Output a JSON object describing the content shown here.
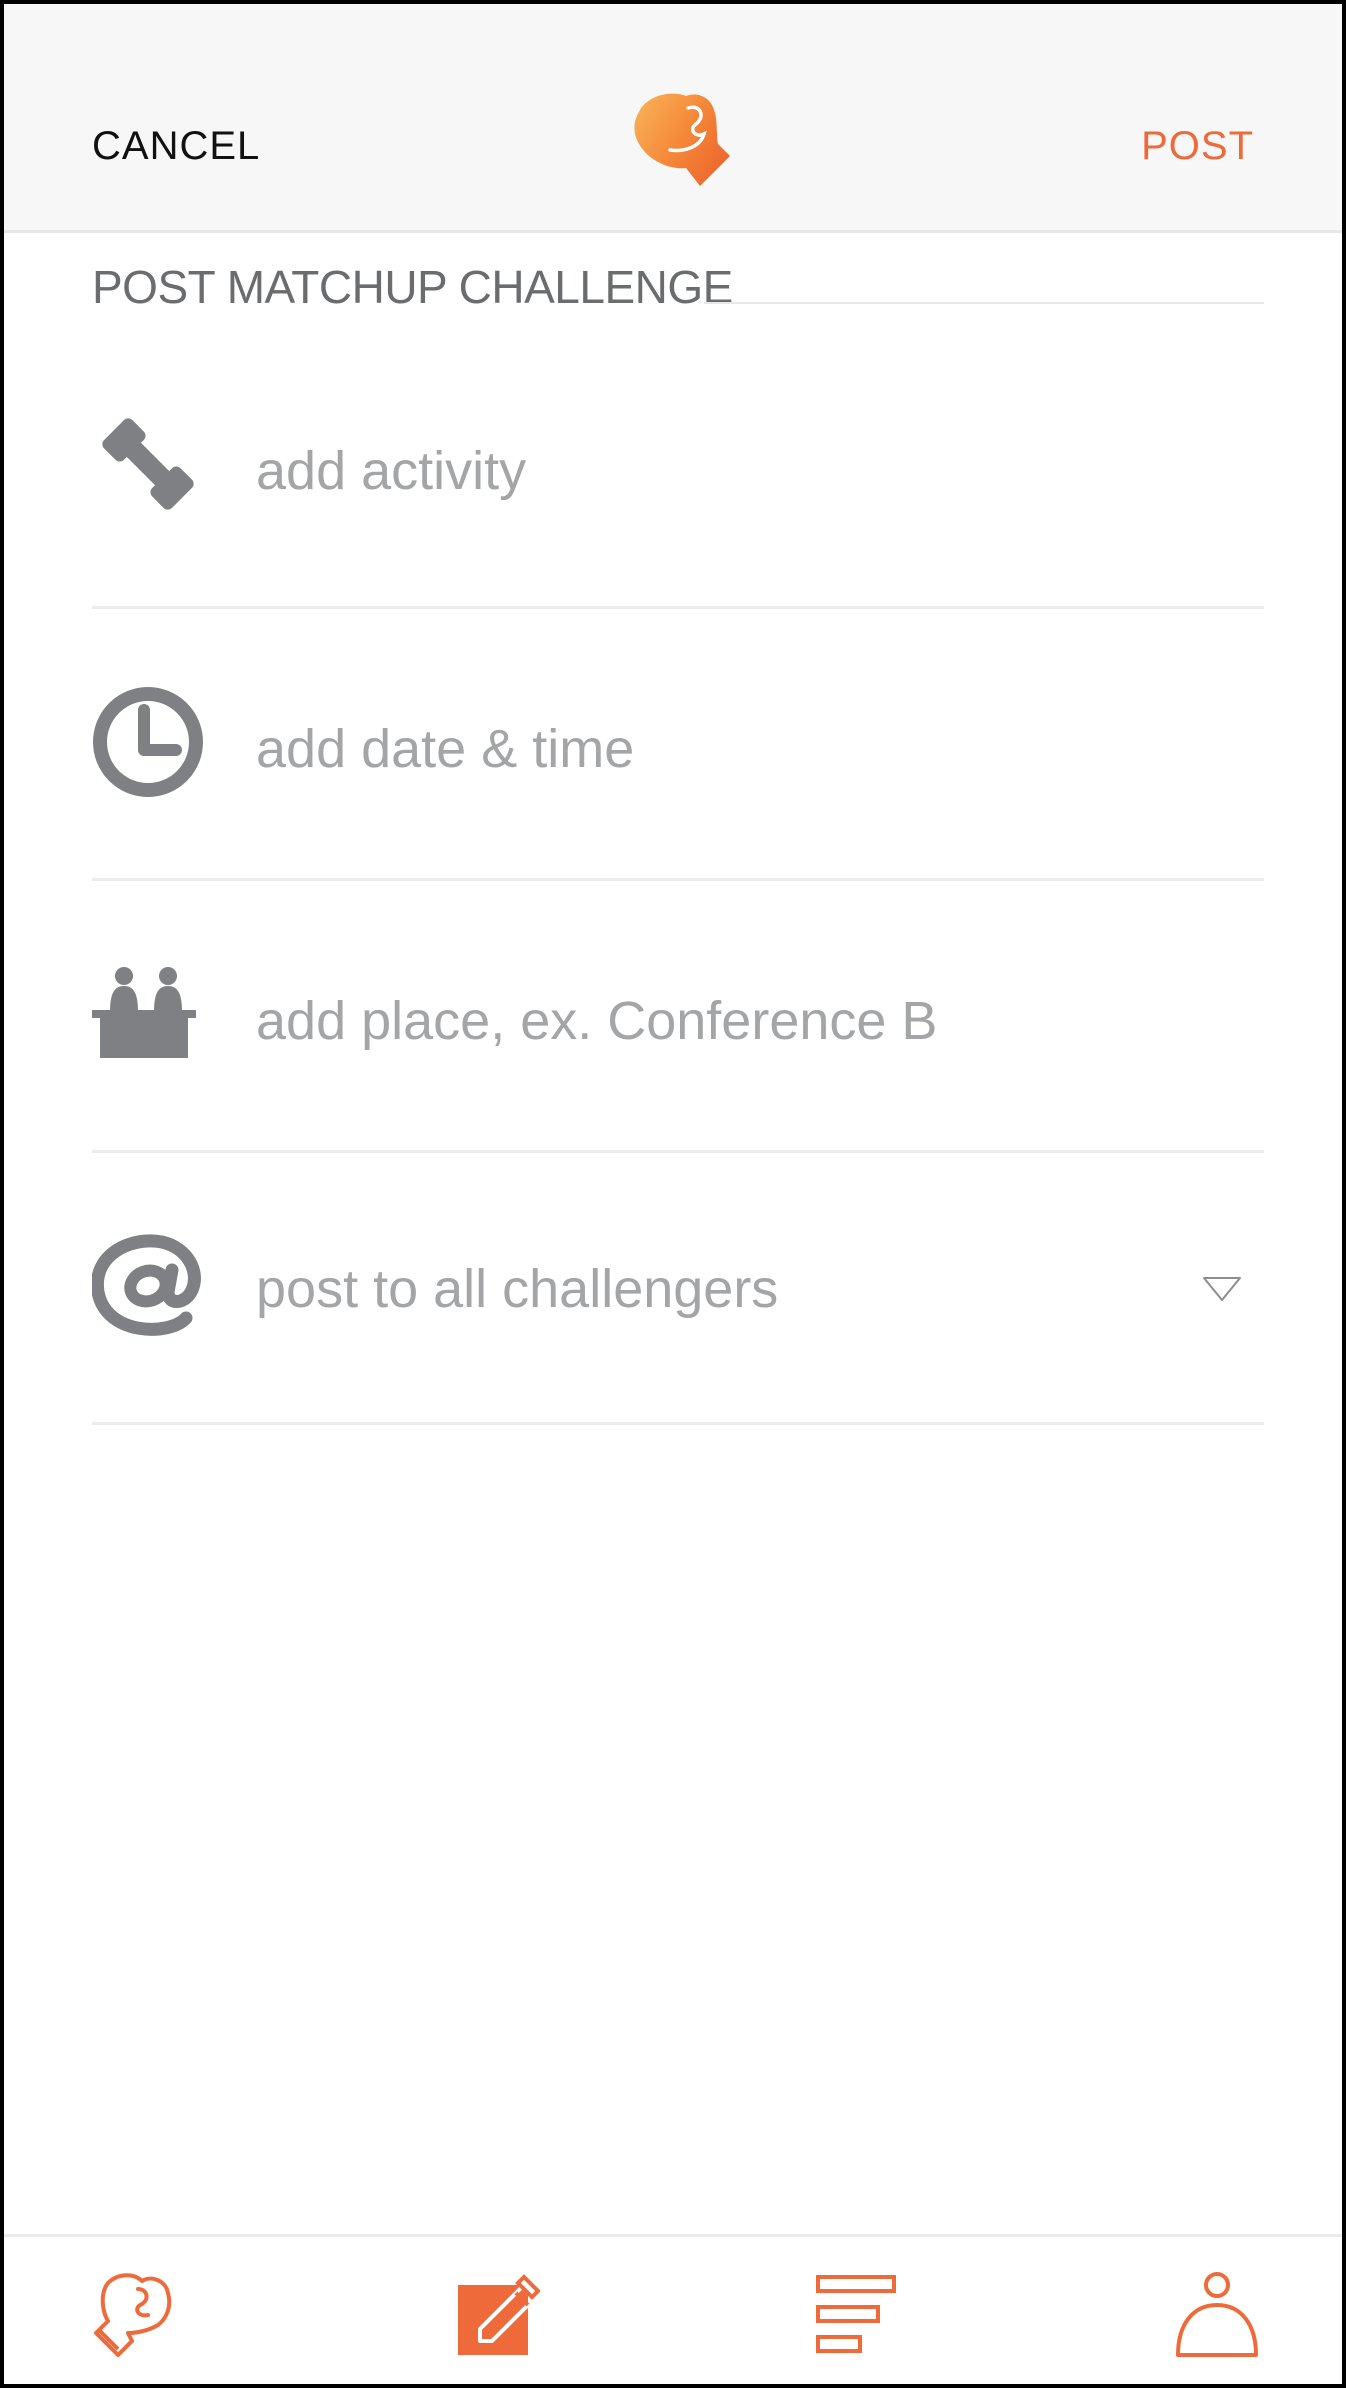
{
  "header": {
    "cancel_label": "CANCEL",
    "post_label": "POST",
    "logo_icon": "boxing-glove-logo"
  },
  "form": {
    "title": "POST MATCHUP CHALLENGE",
    "rows": [
      {
        "icon": "dumbbell-icon",
        "placeholder": "add activity"
      },
      {
        "icon": "clock-icon",
        "placeholder": "add date & time"
      },
      {
        "icon": "meeting-table-icon",
        "placeholder": "add place, ex. Conference B"
      },
      {
        "icon": "at-sign-icon",
        "placeholder": "post to all challengers",
        "has_dropdown": true
      }
    ]
  },
  "tabbar": {
    "tabs": [
      {
        "icon": "boxing-glove-icon"
      },
      {
        "icon": "compose-icon",
        "active": true
      },
      {
        "icon": "list-bars-icon"
      },
      {
        "icon": "profile-icon"
      }
    ]
  },
  "colors": {
    "accent": "#ef6a3a",
    "icon_gray": "#7f8083",
    "placeholder_gray": "#a4a5a7",
    "header_bg": "#f6f7f6"
  }
}
